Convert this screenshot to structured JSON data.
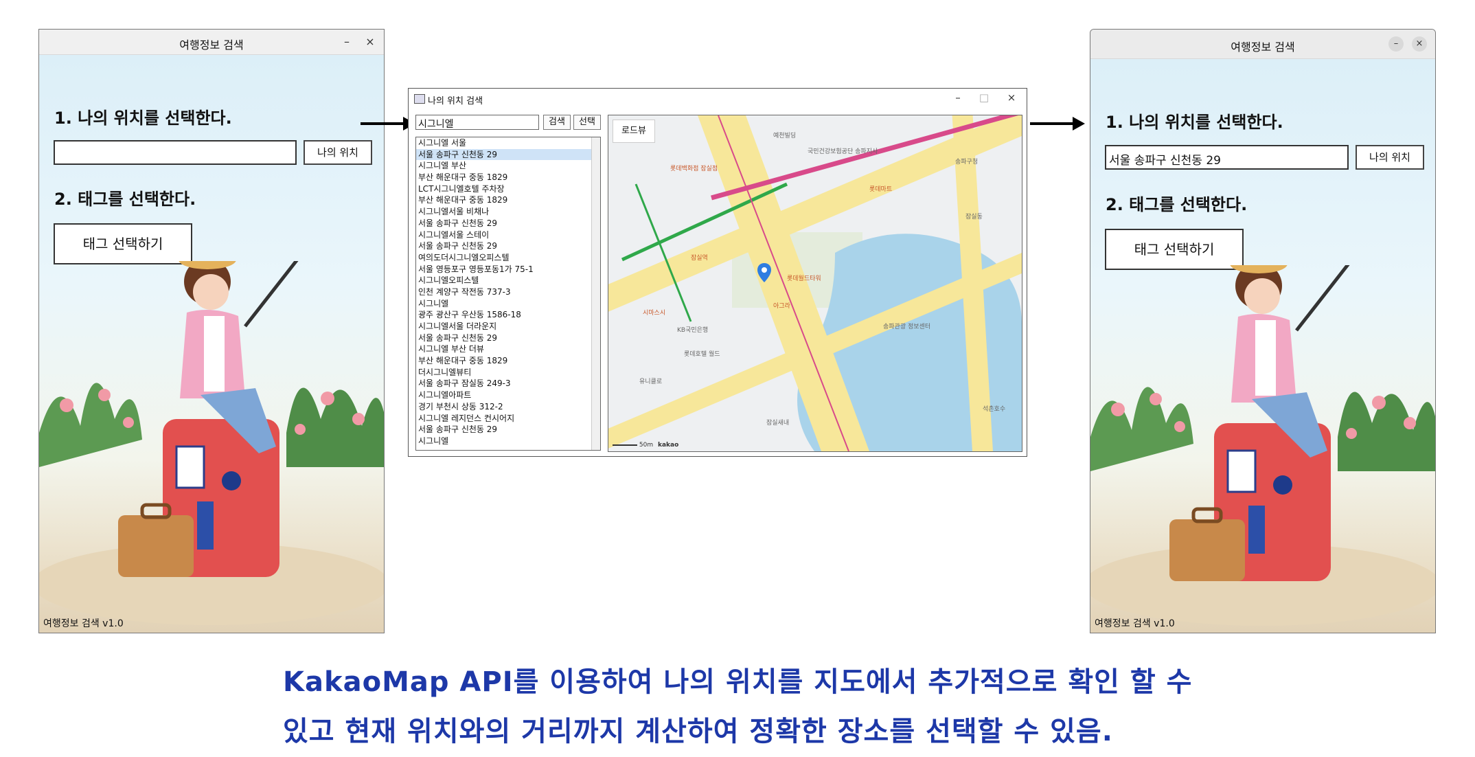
{
  "left_app": {
    "title": "여행정보 검색",
    "minimize": "–",
    "close": "×",
    "step1": "1. 나의 위치를 선택한다.",
    "location_value": "",
    "my_location_button": "나의 위치",
    "step2": "2. 태그를 선택한다.",
    "tag_button": "태그 선택하기",
    "version": "여행정보 검색 v1.0"
  },
  "map_window": {
    "title": "나의 위치 검색",
    "minimize": "–",
    "maximize": "□",
    "close": "×",
    "search_value": "시그니엘",
    "search_button": "검색",
    "select_button": "선택",
    "roadview_button": "로드뷰",
    "results": [
      "시그니엘 서울",
      "서울 송파구 신천동 29",
      "시그니엘 부산",
      "부산 해운대구 중동 1829",
      "LCT시그니엘호텔 주차장",
      "부산 해운대구 중동 1829",
      "시그니엘서울 비채나",
      "서울 송파구 신천동 29",
      "시그니엘서울 스테이",
      "서울 송파구 신천동 29",
      "여의도더시그니엘오피스텔",
      "서울 영등포구 영등포동1가 75-1",
      "시그니엘오피스텔",
      "인천 계양구 작전동 737-3",
      "시그니엘",
      "광주 광산구 우산동 1586-18",
      "시그니엘서울 더라운지",
      "서울 송파구 신천동 29",
      "시그니엘 부산 더뷰",
      "부산 해운대구 중동 1829",
      "더시그니엘뷰티",
      "서울 송파구 잠실동 249-3",
      "시그니엘아파트",
      "경기 부천시 상동 312-2",
      "시그니엘 레지던스 컨시어지",
      "서울 송파구 신천동 29",
      "시그니엘"
    ],
    "selected_index": 1,
    "map_labels": [
      "예천빌딩",
      "국민건강보험공단 송파지사",
      "롯데백화점 잠실점",
      "롯데마트",
      "송파구청",
      "잠실동",
      "석촌호수",
      "롯데월드타워",
      "잠실역",
      "롯데호텔 월드",
      "KB국민은행",
      "송파관광 정보센터",
      "유니클로",
      "시마스시",
      "아그라",
      "잠실새내"
    ],
    "scale_label": "50m",
    "map_provider": "kakao"
  },
  "right_app": {
    "title": "여행정보 검색",
    "minimize": "–",
    "close": "×",
    "step1": "1. 나의 위치를 선택한다.",
    "location_value": "서울 송파구 신천동 29",
    "my_location_button": "나의 위치",
    "step2": "2. 태그를 선택한다.",
    "tag_button": "태그 선택하기",
    "version": "여행정보 검색 v1.0"
  },
  "caption": {
    "line1": "KakaoMap API를 이용하여 나의 위치를 지도에서 추가적으로 확인 할 수",
    "line2": "있고 현재 위치와의 거리까지 계산하여 정확한 장소를 선택할 수 있음."
  },
  "colors": {
    "caption": "#1d38a8",
    "map_water": "#a9d3ea",
    "map_road": "#f7e79a",
    "map_subway": "#d84a8a",
    "pin": "#2f7de1"
  }
}
